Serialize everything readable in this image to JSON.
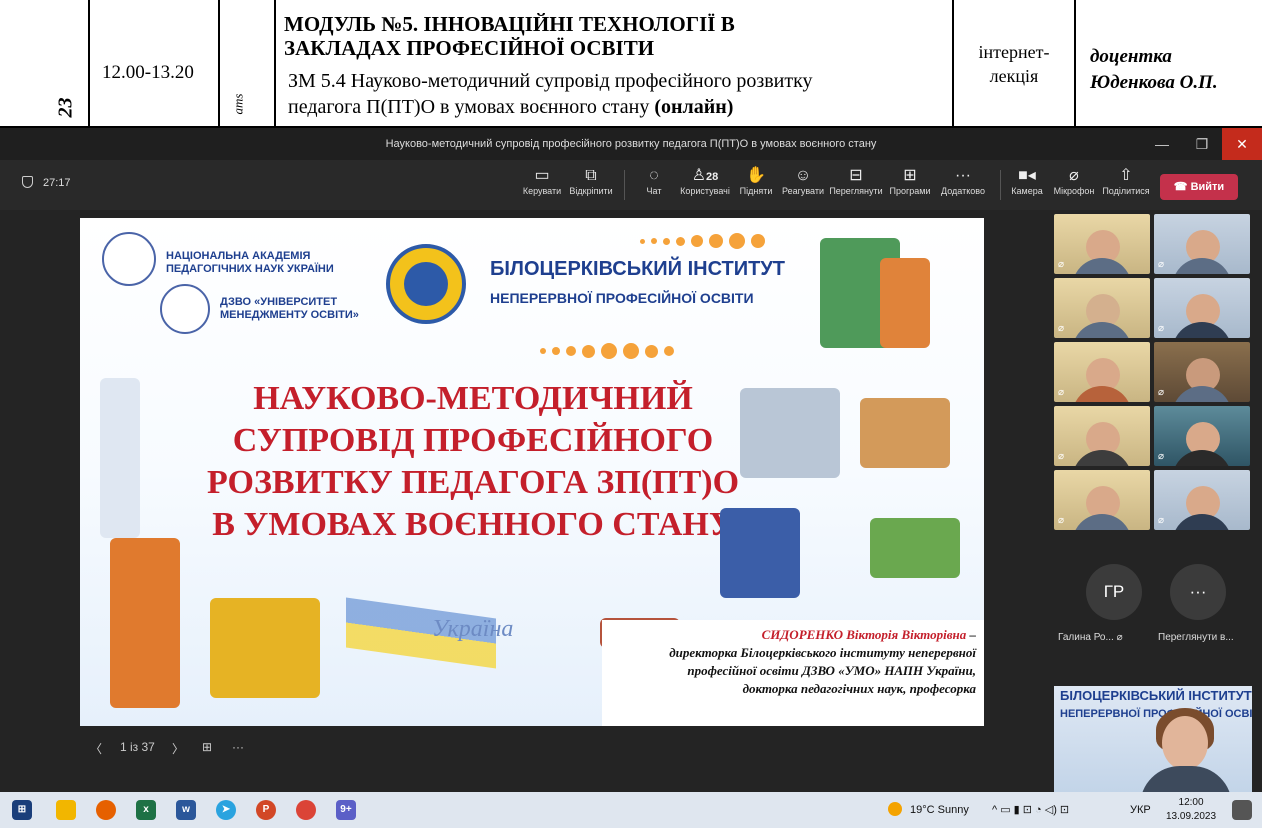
{
  "document": {
    "side_a": "23",
    "side_b": "ams",
    "time": "12.00-13.20",
    "module_title_line1": "МОДУЛЬ №5. ІННОВАЦІЙНІ ТЕХНОЛОГІЇ В",
    "module_title_line2": "ЗАКЛАДАХ ПРОФЕСІЙНОЇ ОСВІТИ",
    "submodule_line1": "ЗМ 5.4 Науково-методичний супровід професійного розвитку",
    "submodule_line2": "педагога П(ПТ)О в умовах воєнного стану",
    "submodule_mode": "(онлайн)",
    "kind_line1": "інтернет-",
    "kind_line2": "лекція",
    "lecturer_line1": "доцентка",
    "lecturer_line2": "Юденкова О.П."
  },
  "window": {
    "title": "Науково-методичний супровід професійного розвитку педагога П(ПТ)О в умовах воєнного стану",
    "minimize": "—",
    "restore": "❐",
    "close": "✕"
  },
  "toolbar": {
    "timer": "27:17",
    "manage": "Керувати",
    "popout": "Відкріпити",
    "chat": "Чат",
    "people_count": "28",
    "people": "Користувачі",
    "raise": "Підняти",
    "react": "Реагувати",
    "view": "Переглянути",
    "apps": "Програми",
    "more": "Додатково",
    "more_icon": "···",
    "camera": "Камера",
    "mic": "Мікрофон",
    "share": "Поділитися",
    "leave": "Вийти",
    "accent_leave": "#c4314b"
  },
  "slide": {
    "nan_line1": "НАЦІОНАЛЬНА АКАДЕМІЯ",
    "nan_line2": "ПЕДАГОГІЧНИХ НАУК УКРАЇНИ",
    "dzvo_line1": "ДЗВО «УНІВЕРСИТЕТ",
    "dzvo_line2": "МЕНЕДЖМЕНТУ ОСВІТИ»",
    "institute_line1": "БІЛОЦЕРКІВСЬКИЙ ІНСТИТУТ",
    "institute_line2": "НЕПЕРЕРВНОЇ ПРОФЕСІЙНОЇ ОСВІТИ",
    "title_line1": "НАУКОВО-МЕТОДИЧНИЙ",
    "title_line2": "СУПРОВІД ПРОФЕСІЙНОГО",
    "title_line3": "РОЗВИТКУ ПЕДАГОГА ЗП(ПТ)О",
    "title_line4": "В УМОВАХ ВОЄННОГО СТАНУ",
    "ukraine_label": "Україна",
    "speaker_name": "СИДОРЕНКО Вікторія Вікторівна",
    "speaker_dash": " –",
    "speaker_line2": "директорка Білоцерківського інституту неперервної",
    "speaker_line3": "професійної освіти ДЗВО «УМО» НАПН України,",
    "speaker_line4": "докторка педагогічних наук, професорка",
    "title_color": "#c41f2b",
    "brand_color": "#1e3f8f"
  },
  "slide_nav": {
    "prev": "〈",
    "counter": "1 із 37",
    "next": "〉",
    "grid_icon": "⊞",
    "more": "···"
  },
  "participants": {
    "avatar_initials": "ГР",
    "avatar_name": "Галина Ро...",
    "more_label": "Переглянути в...",
    "more_icon": "···",
    "self_banner1": "БІЛОЦЕРКІВСЬКИЙ ІНСТИТУТ",
    "self_banner2": "НЕПЕРЕРВНОЇ ПРОФЕСІЙНОЇ ОСВІТИ"
  },
  "taskbar": {
    "weather": "19°C  Sunny",
    "lang": "УКР",
    "time": "12:00",
    "date": "13.09.2023",
    "teams_badge": "9+"
  }
}
